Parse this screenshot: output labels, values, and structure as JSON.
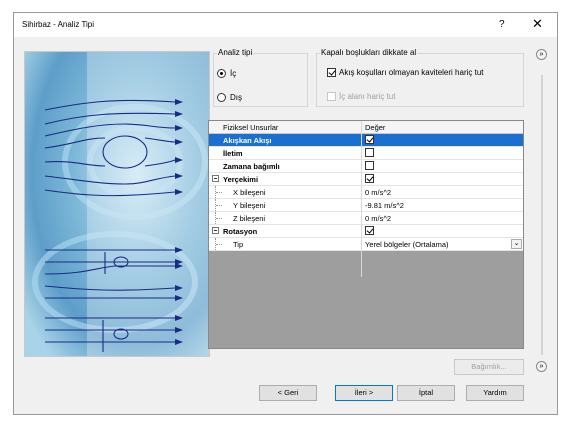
{
  "window": {
    "title": "Sihirbaz - Analiz Tipi",
    "help": "?",
    "close": "✕"
  },
  "analysis_type": {
    "title": "Analiz tipi",
    "options": [
      {
        "label": "İç",
        "selected": true
      },
      {
        "label": "Dış",
        "selected": false
      }
    ]
  },
  "closed_cavities": {
    "title": "Kapalı boşlukları dikkate al",
    "options": [
      {
        "label": "Akış koşulları olmayan kaviteleri hariç tut",
        "checked": true,
        "enabled": true
      },
      {
        "label": "İç alanı hariç tut",
        "checked": false,
        "enabled": false
      }
    ]
  },
  "table": {
    "headers": [
      "Fiziksel Unsurlar",
      "Değer"
    ],
    "rows": [
      {
        "name": "Akışkan Akışı",
        "value": "",
        "checked": true,
        "bold": true,
        "selected": true
      },
      {
        "name": "İletim",
        "value": "",
        "checked": false,
        "bold": true
      },
      {
        "name": "Zamana bağımlı",
        "value": "",
        "checked": false,
        "bold": true
      },
      {
        "name": "Yerçekimi",
        "value": "",
        "checked": true,
        "bold": true,
        "expander": true
      },
      {
        "name": "X bileşeni",
        "value": "0 m/s^2",
        "child": true
      },
      {
        "name": "Y bileşeni",
        "value": "-9.81 m/s^2",
        "child": true
      },
      {
        "name": "Z bileşeni",
        "value": "0 m/s^2",
        "child": true
      },
      {
        "name": "Rotasyon",
        "value": "",
        "checked": true,
        "bold": true,
        "expander": true
      },
      {
        "name": "Tip",
        "value": "Yerel bölgeler (Ortalama)",
        "child": true,
        "dropdown": true
      }
    ]
  },
  "buttons": {
    "dependency": "Bağımlık...",
    "back": "< Geri",
    "next": "İleri >",
    "cancel": "İptal",
    "help": "Yardım"
  },
  "nav_arrows": {
    "top": "»",
    "bottom": "»"
  },
  "colors": {
    "selection": "#1a6fd0",
    "gray_area": "#9e9e9e",
    "image_bg": "#8ec3e0"
  }
}
